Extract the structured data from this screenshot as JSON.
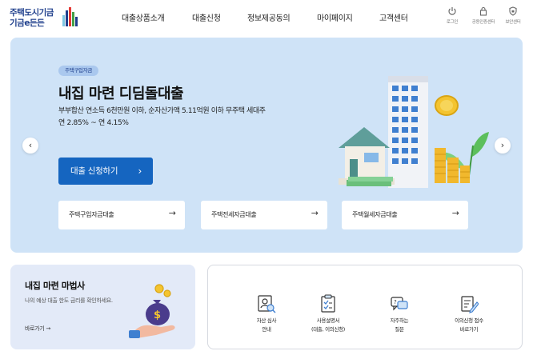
{
  "header": {
    "logo": {
      "line1": "주택도시기금",
      "line2": "기금e든든"
    },
    "nav": [
      "대출상품소개",
      "대출신청",
      "정보제공동의",
      "마이페이지",
      "고객센터"
    ],
    "utils": [
      {
        "label": "로그인",
        "icon": "power-icon"
      },
      {
        "label": "공동인증센터",
        "icon": "lock-icon"
      },
      {
        "label": "보안센터",
        "icon": "shield-icon"
      }
    ]
  },
  "hero": {
    "badge": "주택구입자금",
    "title": "내집 마련 디딤돌대출",
    "desc": "부부합산 연소득 6천만원 이하, 순자산가액 5.11억원 이하 무주택 세대주",
    "rate": "연 2.85% ~ 연 4.15%",
    "cta": "대출 신청하기",
    "quick_links": [
      "주택구입자금대출",
      "주택전세자금대출",
      "주택월세자금대출"
    ]
  },
  "wizard": {
    "title": "내집 마련 마법사",
    "desc": "나의 예상 대출 한도 금리를 확인하세요.",
    "link": "바로가기 →"
  },
  "services": [
    {
      "line1": "자산 심사",
      "line2": "안내",
      "icon": "asset-review-icon"
    },
    {
      "line1": "사용설명서",
      "line2": "(대출, 이의신청)",
      "icon": "manual-icon"
    },
    {
      "line1": "자주하는",
      "line2": "질문",
      "icon": "faq-icon"
    },
    {
      "line1": "이의신청 접수",
      "line2": "바로가기",
      "icon": "objection-icon"
    }
  ],
  "colors": {
    "brand": "#1f3f8c",
    "cta": "#1565c0",
    "hero_bg": "#cfe3f7",
    "wizard_bg": "#e3eaf8"
  }
}
